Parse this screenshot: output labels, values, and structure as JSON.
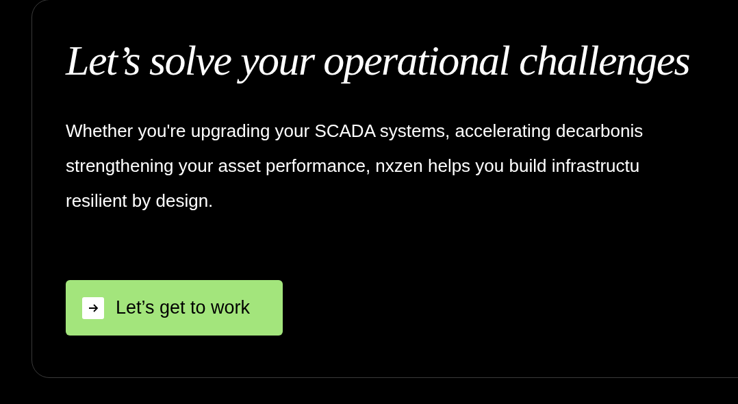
{
  "card": {
    "heading": "Let’s solve your operational challenges",
    "paragraph_lines": [
      "Whether you're upgrading your SCADA systems, accelerating decarbonis",
      "strengthening your asset performance, nxzen helps you build infrastructu",
      "resilient by design."
    ],
    "button": {
      "label": "Let’s get to work"
    }
  }
}
